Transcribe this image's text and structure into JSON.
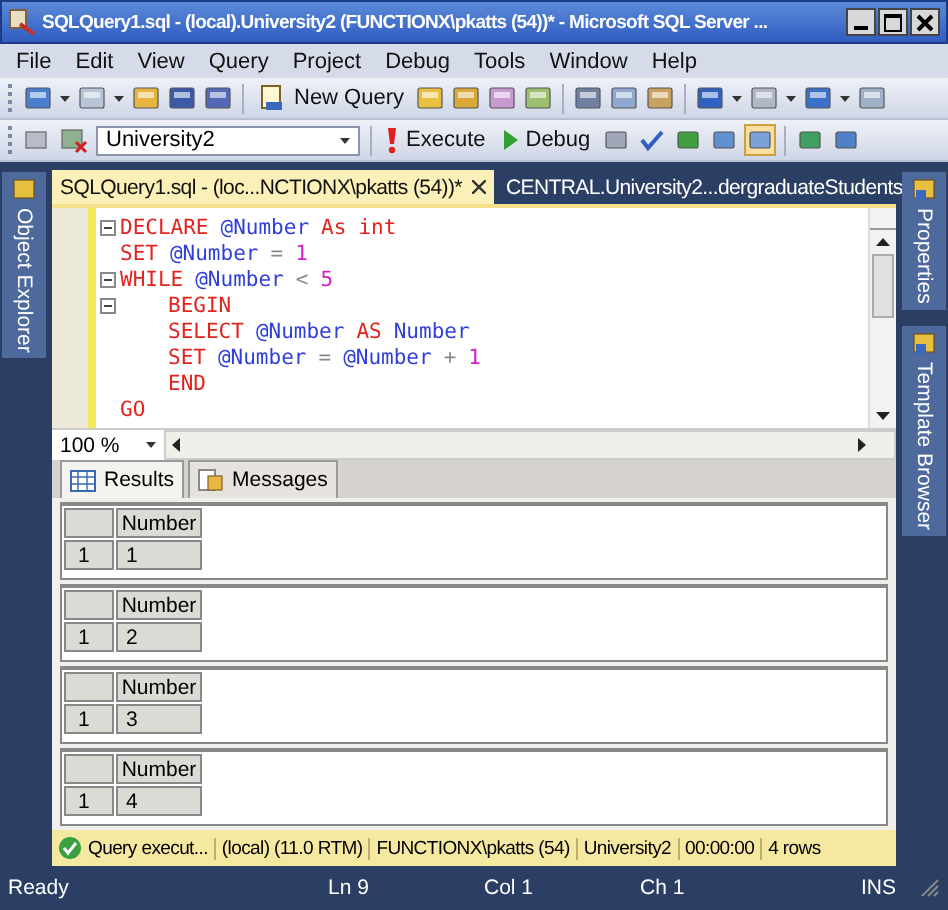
{
  "window": {
    "title": "SQLQuery1.sql - (local).University2 (FUNCTIONX\\pkatts (54))* - Microsoft SQL Server ..."
  },
  "menu": [
    "File",
    "Edit",
    "View",
    "Query",
    "Project",
    "Debug",
    "Tools",
    "Window",
    "Help"
  ],
  "toolbar": {
    "new_query": "New Query",
    "database": "University2",
    "execute": "Execute",
    "debug": "Debug"
  },
  "side_panels": {
    "left": [
      "Object Explorer"
    ],
    "right": [
      "Properties",
      "Template Browser"
    ]
  },
  "doc_tabs": [
    {
      "label": "SQLQuery1.sql - (loc...NCTIONX\\pkatts (54))*",
      "selected": true
    },
    {
      "label": "CENTRAL.University2...dergraduateStudents",
      "selected": false
    }
  ],
  "editor": {
    "zoom": "100 %",
    "lines": [
      {
        "fold": true,
        "indent": false,
        "tokens": [
          {
            "kind": "keyword",
            "text": "DECLARE"
          },
          {
            "kind": "variable",
            "text": "@Number"
          },
          {
            "kind": "keyword",
            "text": "As"
          },
          {
            "kind": "keyword",
            "text": "int"
          }
        ]
      },
      {
        "fold": false,
        "indent": false,
        "tokens": [
          {
            "kind": "keyword",
            "text": "SET"
          },
          {
            "kind": "variable",
            "text": "@Number"
          },
          {
            "kind": "operator",
            "text": "="
          },
          {
            "kind": "number",
            "text": "1"
          }
        ]
      },
      {
        "fold": true,
        "indent": false,
        "tokens": [
          {
            "kind": "keyword",
            "text": "WHILE"
          },
          {
            "kind": "variable",
            "text": "@Number"
          },
          {
            "kind": "operator",
            "text": "<"
          },
          {
            "kind": "number",
            "text": "5"
          }
        ]
      },
      {
        "fold": true,
        "indent": true,
        "tokens": [
          {
            "kind": "keyword",
            "text": "BEGIN"
          }
        ]
      },
      {
        "fold": false,
        "indent": true,
        "tokens": [
          {
            "kind": "keyword",
            "text": "SELECT"
          },
          {
            "kind": "variable",
            "text": "@Number"
          },
          {
            "kind": "keyword",
            "text": "AS"
          },
          {
            "kind": "variable",
            "text": "Number"
          }
        ]
      },
      {
        "fold": false,
        "indent": true,
        "tokens": [
          {
            "kind": "keyword",
            "text": "SET"
          },
          {
            "kind": "variable",
            "text": "@Number"
          },
          {
            "kind": "operator",
            "text": "="
          },
          {
            "kind": "variable",
            "text": "@Number"
          },
          {
            "kind": "operator",
            "text": "+"
          },
          {
            "kind": "number",
            "text": "1"
          }
        ]
      },
      {
        "fold": false,
        "indent": true,
        "tokens": [
          {
            "kind": "keyword",
            "text": "END"
          }
        ]
      },
      {
        "fold": false,
        "indent": false,
        "tokens": [
          {
            "kind": "keyword",
            "text": "GO"
          }
        ]
      }
    ]
  },
  "results": {
    "tabs": [
      {
        "label": "Results",
        "selected": true
      },
      {
        "label": "Messages",
        "selected": false
      }
    ],
    "grids": [
      {
        "column": "Number",
        "rows": [
          {
            "row_number": "1",
            "value": "1"
          }
        ]
      },
      {
        "column": "Number",
        "rows": [
          {
            "row_number": "1",
            "value": "2"
          }
        ]
      },
      {
        "column": "Number",
        "rows": [
          {
            "row_number": "1",
            "value": "3"
          }
        ]
      },
      {
        "column": "Number",
        "rows": [
          {
            "row_number": "1",
            "value": "4"
          }
        ]
      }
    ]
  },
  "query_status": {
    "message": "Query execut...",
    "server": "(local) (11.0 RTM)",
    "user": "FUNCTIONX\\pkatts (54)",
    "database": "University2",
    "elapsed": "00:00:00",
    "rows": "4 rows"
  },
  "status_bar": {
    "state": "Ready",
    "line": "Ln 9",
    "column": "Col 1",
    "char": "Ch 1",
    "mode": "INS"
  }
}
